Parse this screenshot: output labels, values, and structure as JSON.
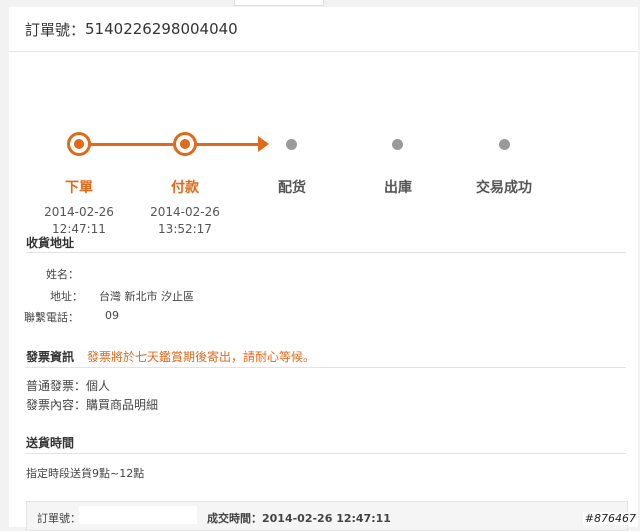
{
  "order": {
    "label": "訂單號：",
    "number": "5140226298004040"
  },
  "progress": {
    "steps": [
      {
        "label": "下單",
        "date": "2014-02-26",
        "time": "12:47:11",
        "status": "done"
      },
      {
        "label": "付款",
        "date": "2014-02-26",
        "time": "13:52:17",
        "status": "done"
      },
      {
        "label": "配货",
        "date": "",
        "time": "",
        "status": "pending"
      },
      {
        "label": "出庫",
        "date": "",
        "time": "",
        "status": "pending"
      },
      {
        "label": "交易成功",
        "date": "",
        "time": "",
        "status": "pending"
      }
    ],
    "accent_color": "#e06a1b",
    "pending_color": "#9a9a9a"
  },
  "shipping_address": {
    "title": "收貨地址",
    "name_label": "姓名：",
    "name_value": "",
    "address_label": "地址：",
    "address_value": "台灣 新北市 汐止區",
    "phone_label": "聯繫電話：",
    "phone_value": "09"
  },
  "invoice": {
    "title": "發票資訊",
    "notice": "發票將於七天鑑賞期後寄出，請耐心等候。",
    "type_line": "普通發票：個人",
    "content_line": "發票內容：購買商品明細"
  },
  "delivery": {
    "title": "送貨時間",
    "value": "指定時段送貨9點~12點"
  },
  "footer": {
    "order_label": "訂單號：",
    "order_value": "",
    "deal_time": "成交時間：2014-02-26 12:47:11"
  },
  "watermark": "#876467"
}
